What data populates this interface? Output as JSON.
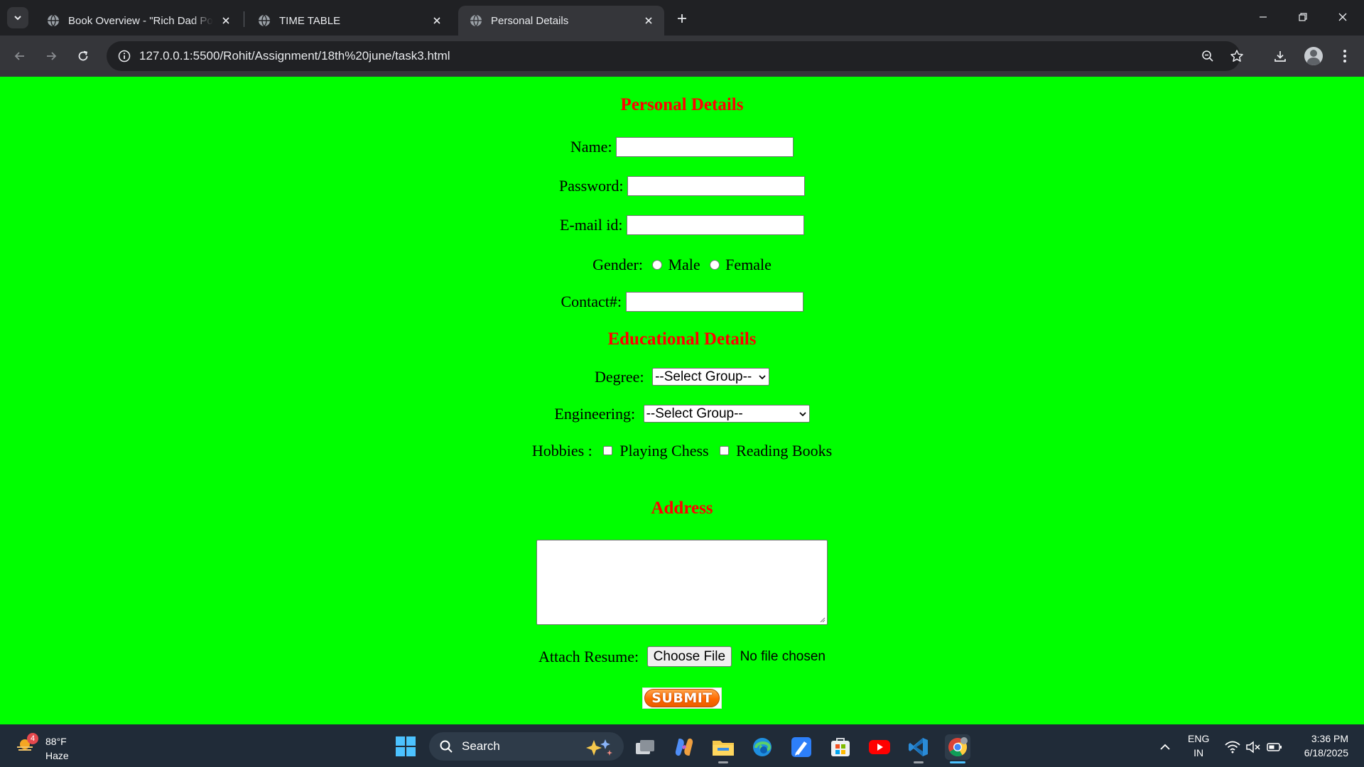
{
  "browser": {
    "tabs": [
      {
        "title": "Book Overview - \"Rich Dad Poor Dad\"",
        "active": false
      },
      {
        "title": "TIME TABLE",
        "active": false
      },
      {
        "title": "Personal Details",
        "active": true
      }
    ],
    "url": "127.0.0.1:5500/Rohit/Assignment/18th%20june/task3.html"
  },
  "form": {
    "personal_heading": "Personal Details",
    "name_label": "Name:",
    "password_label": "Password:",
    "email_label": "E-mail id:",
    "gender_label": "Gender:",
    "gender_options": [
      "Male",
      "Female"
    ],
    "contact_label": "Contact#:",
    "education_heading": "Educational Details",
    "degree_label": "Degree:",
    "degree_selected": "--Select Group--",
    "engineering_label": "Engineering:",
    "engineering_selected": "--Select Group--",
    "hobbies_label": "Hobbies :",
    "hobby_options": [
      "Playing Chess",
      "Reading Books"
    ],
    "address_heading": "Address",
    "resume_label": "Attach Resume:",
    "choose_file_label": "Choose File",
    "file_status": "No file chosen",
    "submit_label": "SUBMIT"
  },
  "taskbar": {
    "weather_temp": "88°F",
    "weather_condition": "Haze",
    "weather_badge": "4",
    "search_label": "Search",
    "language": "ENG",
    "region": "IN",
    "time": "3:36 PM",
    "date": "6/18/2025"
  },
  "colors": {
    "page_background": "#00ff00",
    "heading": "#ff0000",
    "submit": "#ff6a00"
  }
}
